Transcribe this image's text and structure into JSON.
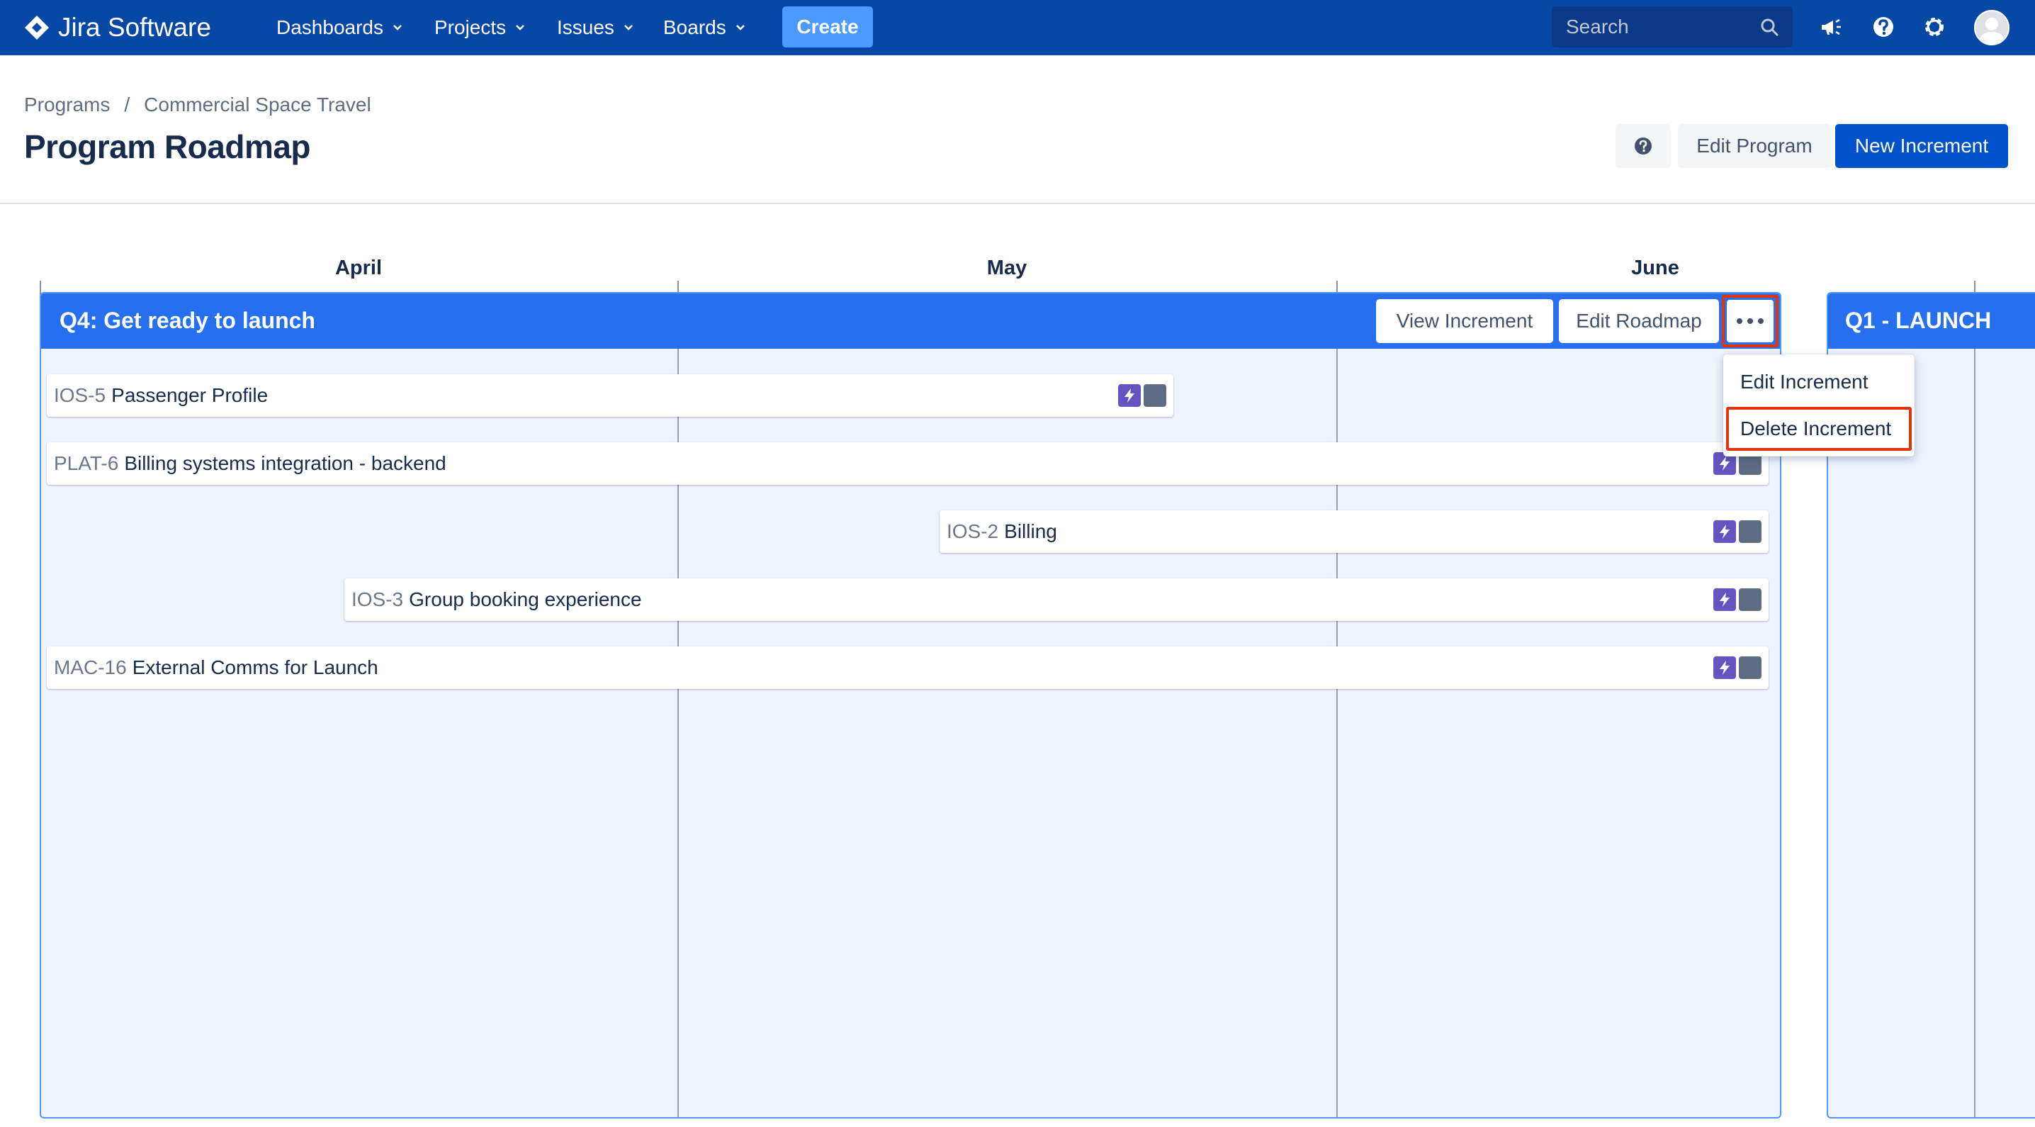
{
  "app": {
    "logo_text": "Jira Software",
    "nav": [
      {
        "label": "Dashboards"
      },
      {
        "label": "Projects"
      },
      {
        "label": "Issues"
      },
      {
        "label": "Boards"
      }
    ],
    "create_label": "Create",
    "search_placeholder": "Search",
    "icons": [
      "megaphone-icon",
      "help-icon",
      "settings-gear-icon",
      "user-avatar"
    ]
  },
  "breadcrumb": [
    "Programs",
    "Commercial Space Travel"
  ],
  "page_title": "Program Roadmap",
  "actions": {
    "edit_program": "Edit Program",
    "new_increment": "New Increment"
  },
  "months": [
    "April",
    "May",
    "June"
  ],
  "increment": {
    "title": "Q4: Get ready to launch",
    "view_label": "View Increment",
    "edit_roadmap_label": "Edit Roadmap",
    "cards": [
      {
        "key": "IOS-5",
        "summary": "Passenger Profile"
      },
      {
        "key": "PLAT-6",
        "summary": "Billing systems integration - backend"
      },
      {
        "key": "IOS-2",
        "summary": "Billing"
      },
      {
        "key": "IOS-3",
        "summary": "Group booking experience"
      },
      {
        "key": "MAC-16",
        "summary": "External Comms for Launch"
      }
    ]
  },
  "next_increment": {
    "title": "Q1 - LAUNCH"
  },
  "menu": {
    "edit_increment": "Edit Increment",
    "delete_increment": "Delete Increment"
  },
  "colors": {
    "nav_bg": "#0747a6",
    "primary": "#0052cc",
    "increment_header": "#2670f0",
    "highlight": "#de350b",
    "epic_badge": "#6554c0"
  }
}
